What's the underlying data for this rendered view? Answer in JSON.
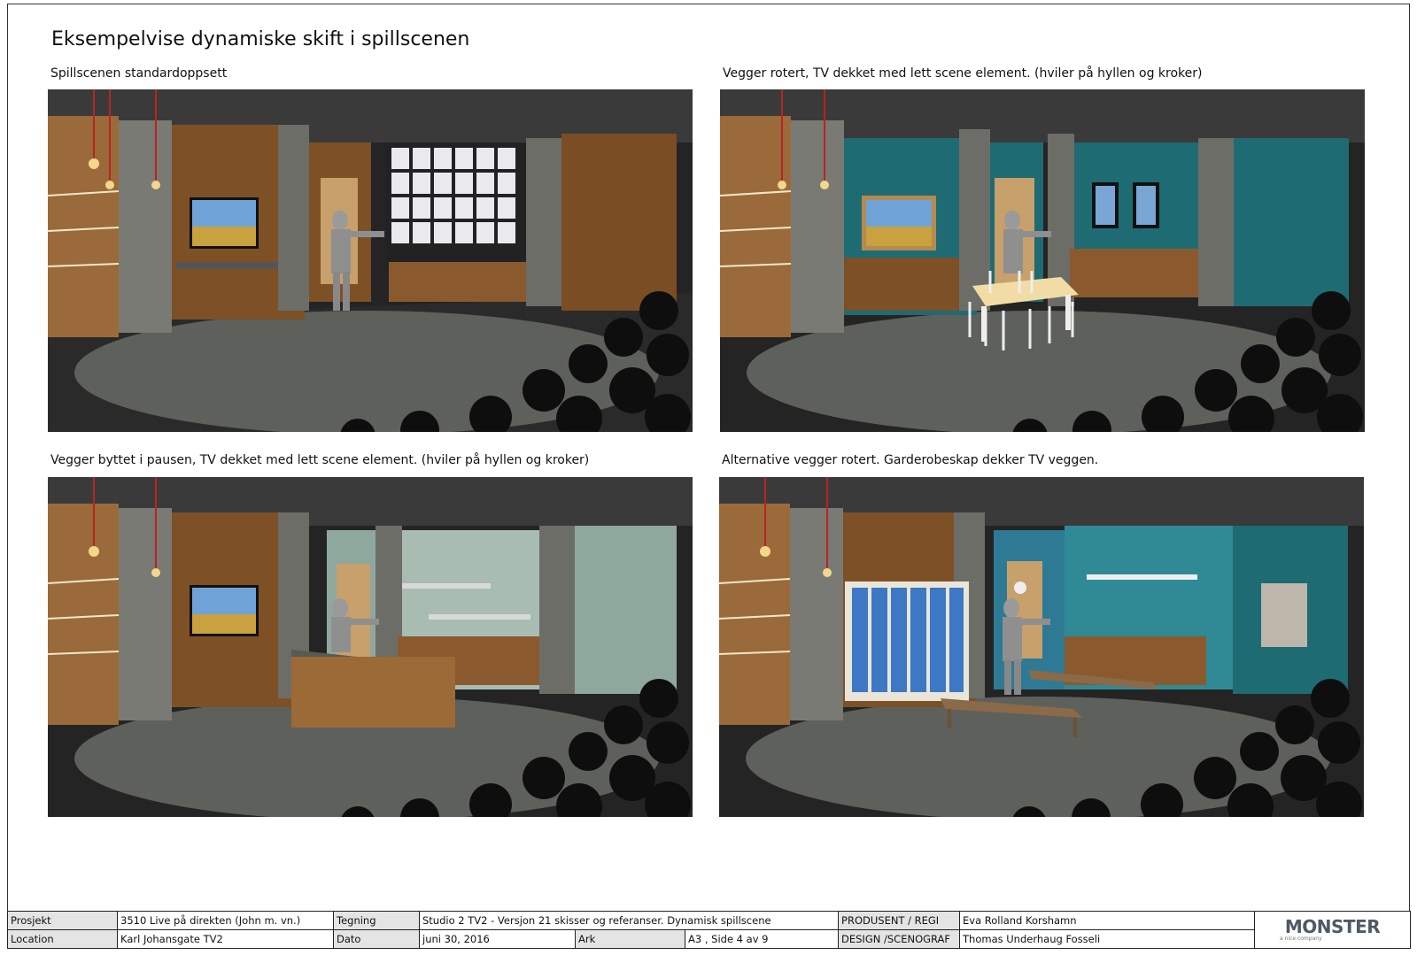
{
  "page": {
    "title": "Eksempelvise dynamiske skift i spillscenen"
  },
  "panels": [
    {
      "caption": "Spillscenen standardoppsett",
      "scene": "standard"
    },
    {
      "caption": "Vegger rotert, TV dekket med lett scene element. (hviler på hyllen og kroker)",
      "scene": "rotated-table"
    },
    {
      "caption": "Vegger byttet i pausen, TV dekket med lett scene element. (hviler på hyllen og kroker)",
      "scene": "counter-shelves"
    },
    {
      "caption": "Alternative vegger rotert. Garderobeskap dekker TV veggen.",
      "scene": "lockers-bench"
    }
  ],
  "title_block": {
    "project_label": "Prosjekt",
    "project_value": "3510 Live på direkten (John m. vn.)",
    "drawing_label": "Tegning",
    "drawing_value": "Studio 2 TV2 - Versjon 21 skisser og referanser. Dynamisk spillscene",
    "producer_label": "PRODUSENT / REGI",
    "producer_value": "Eva Rolland Korshamn",
    "location_label": "Location",
    "location_value": "Karl Johansgate TV2",
    "date_label": "Dato",
    "date_value": "juni 30, 2016",
    "sheet_label": "Ark",
    "sheet_value": "A3 , Side 4 av 9",
    "design_label": "DESIGN /SCENOGRAF",
    "design_value": "Thomas Underhaug Fosseli"
  },
  "logo": {
    "word": "MONSTER",
    "sub": "a nice company"
  },
  "colors": {
    "wood": "#8a5a2e",
    "concrete": "#7a7a74",
    "teal": "#1f6b73",
    "mint": "#8fa89d",
    "floor": "#5e605c",
    "locker_blue": "#3d78c4"
  }
}
